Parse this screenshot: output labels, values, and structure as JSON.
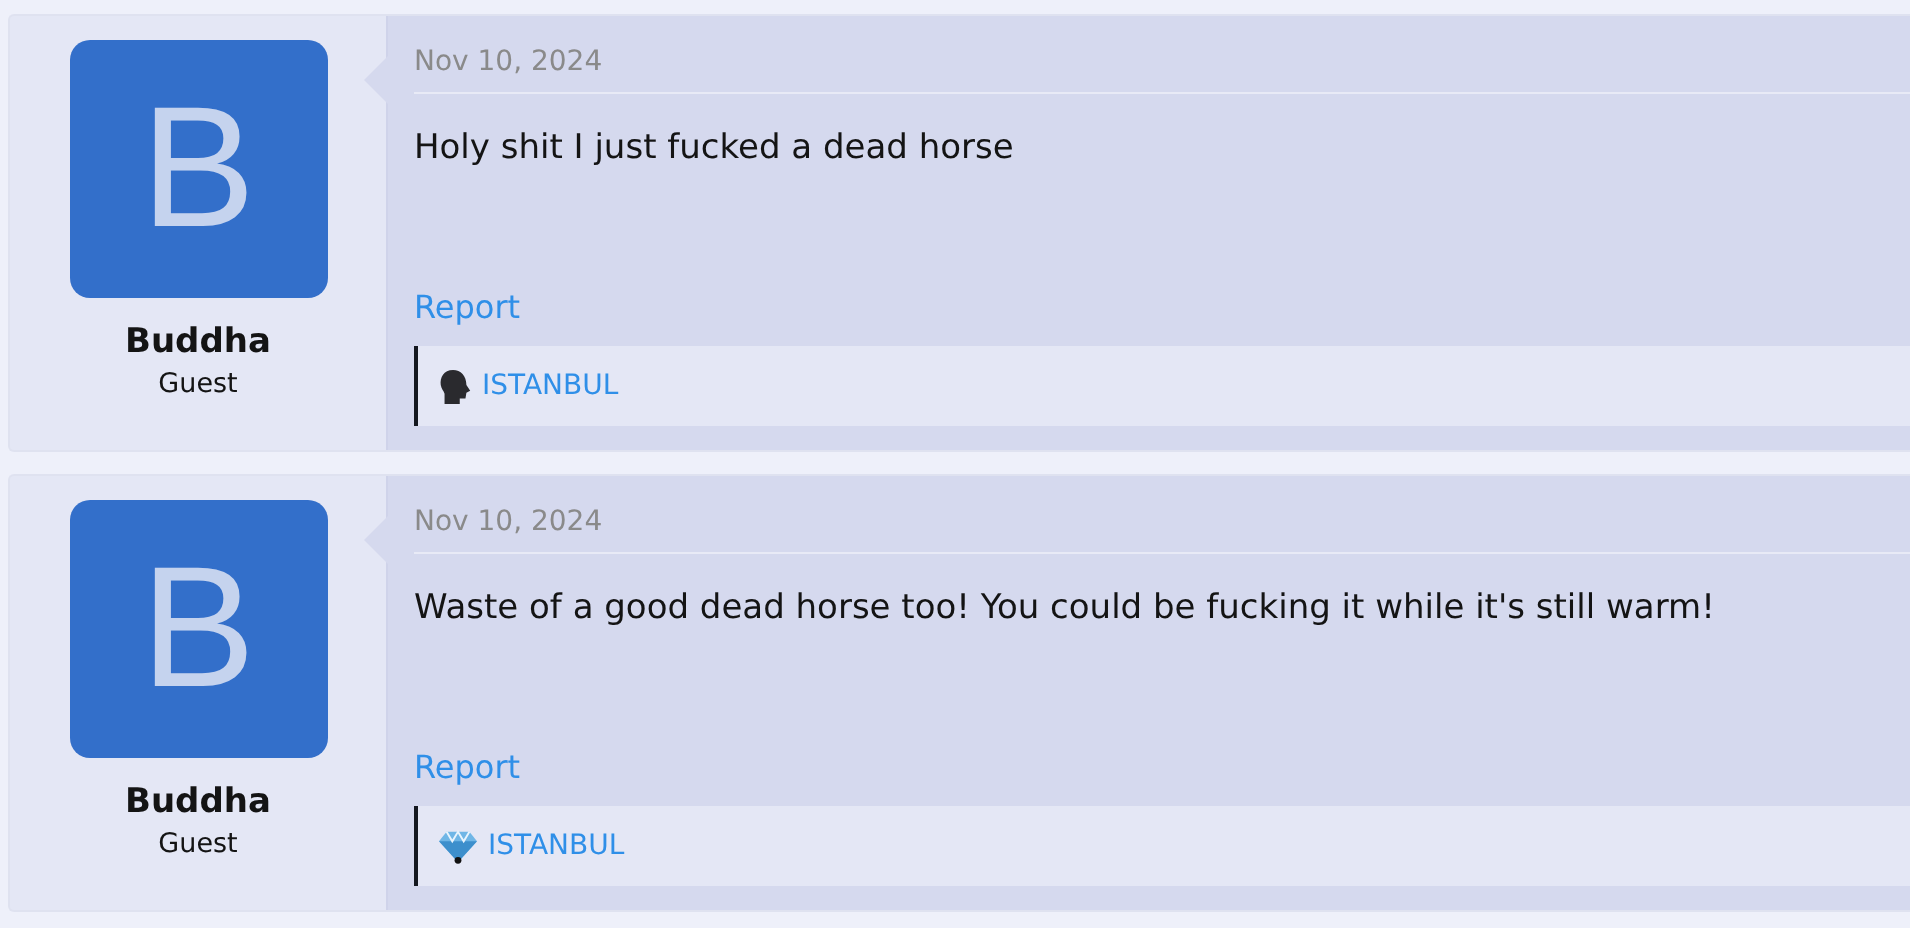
{
  "posts": [
    {
      "avatar_letter": "B",
      "username": "Buddha",
      "user_title": "Guest",
      "date": "Nov 10, 2024",
      "message": "Holy shit I just fucked a dead horse",
      "report": "Report",
      "signature": {
        "kind": "head",
        "text": "ISTANBUL"
      }
    },
    {
      "avatar_letter": "B",
      "username": "Buddha",
      "user_title": "Guest",
      "date": "Nov 10, 2024",
      "message": "Waste of a good dead horse too! You could be fucking it while it's still warm!",
      "report": "Report",
      "signature": {
        "kind": "diamond",
        "text": "ISTANBUL"
      }
    }
  ]
}
